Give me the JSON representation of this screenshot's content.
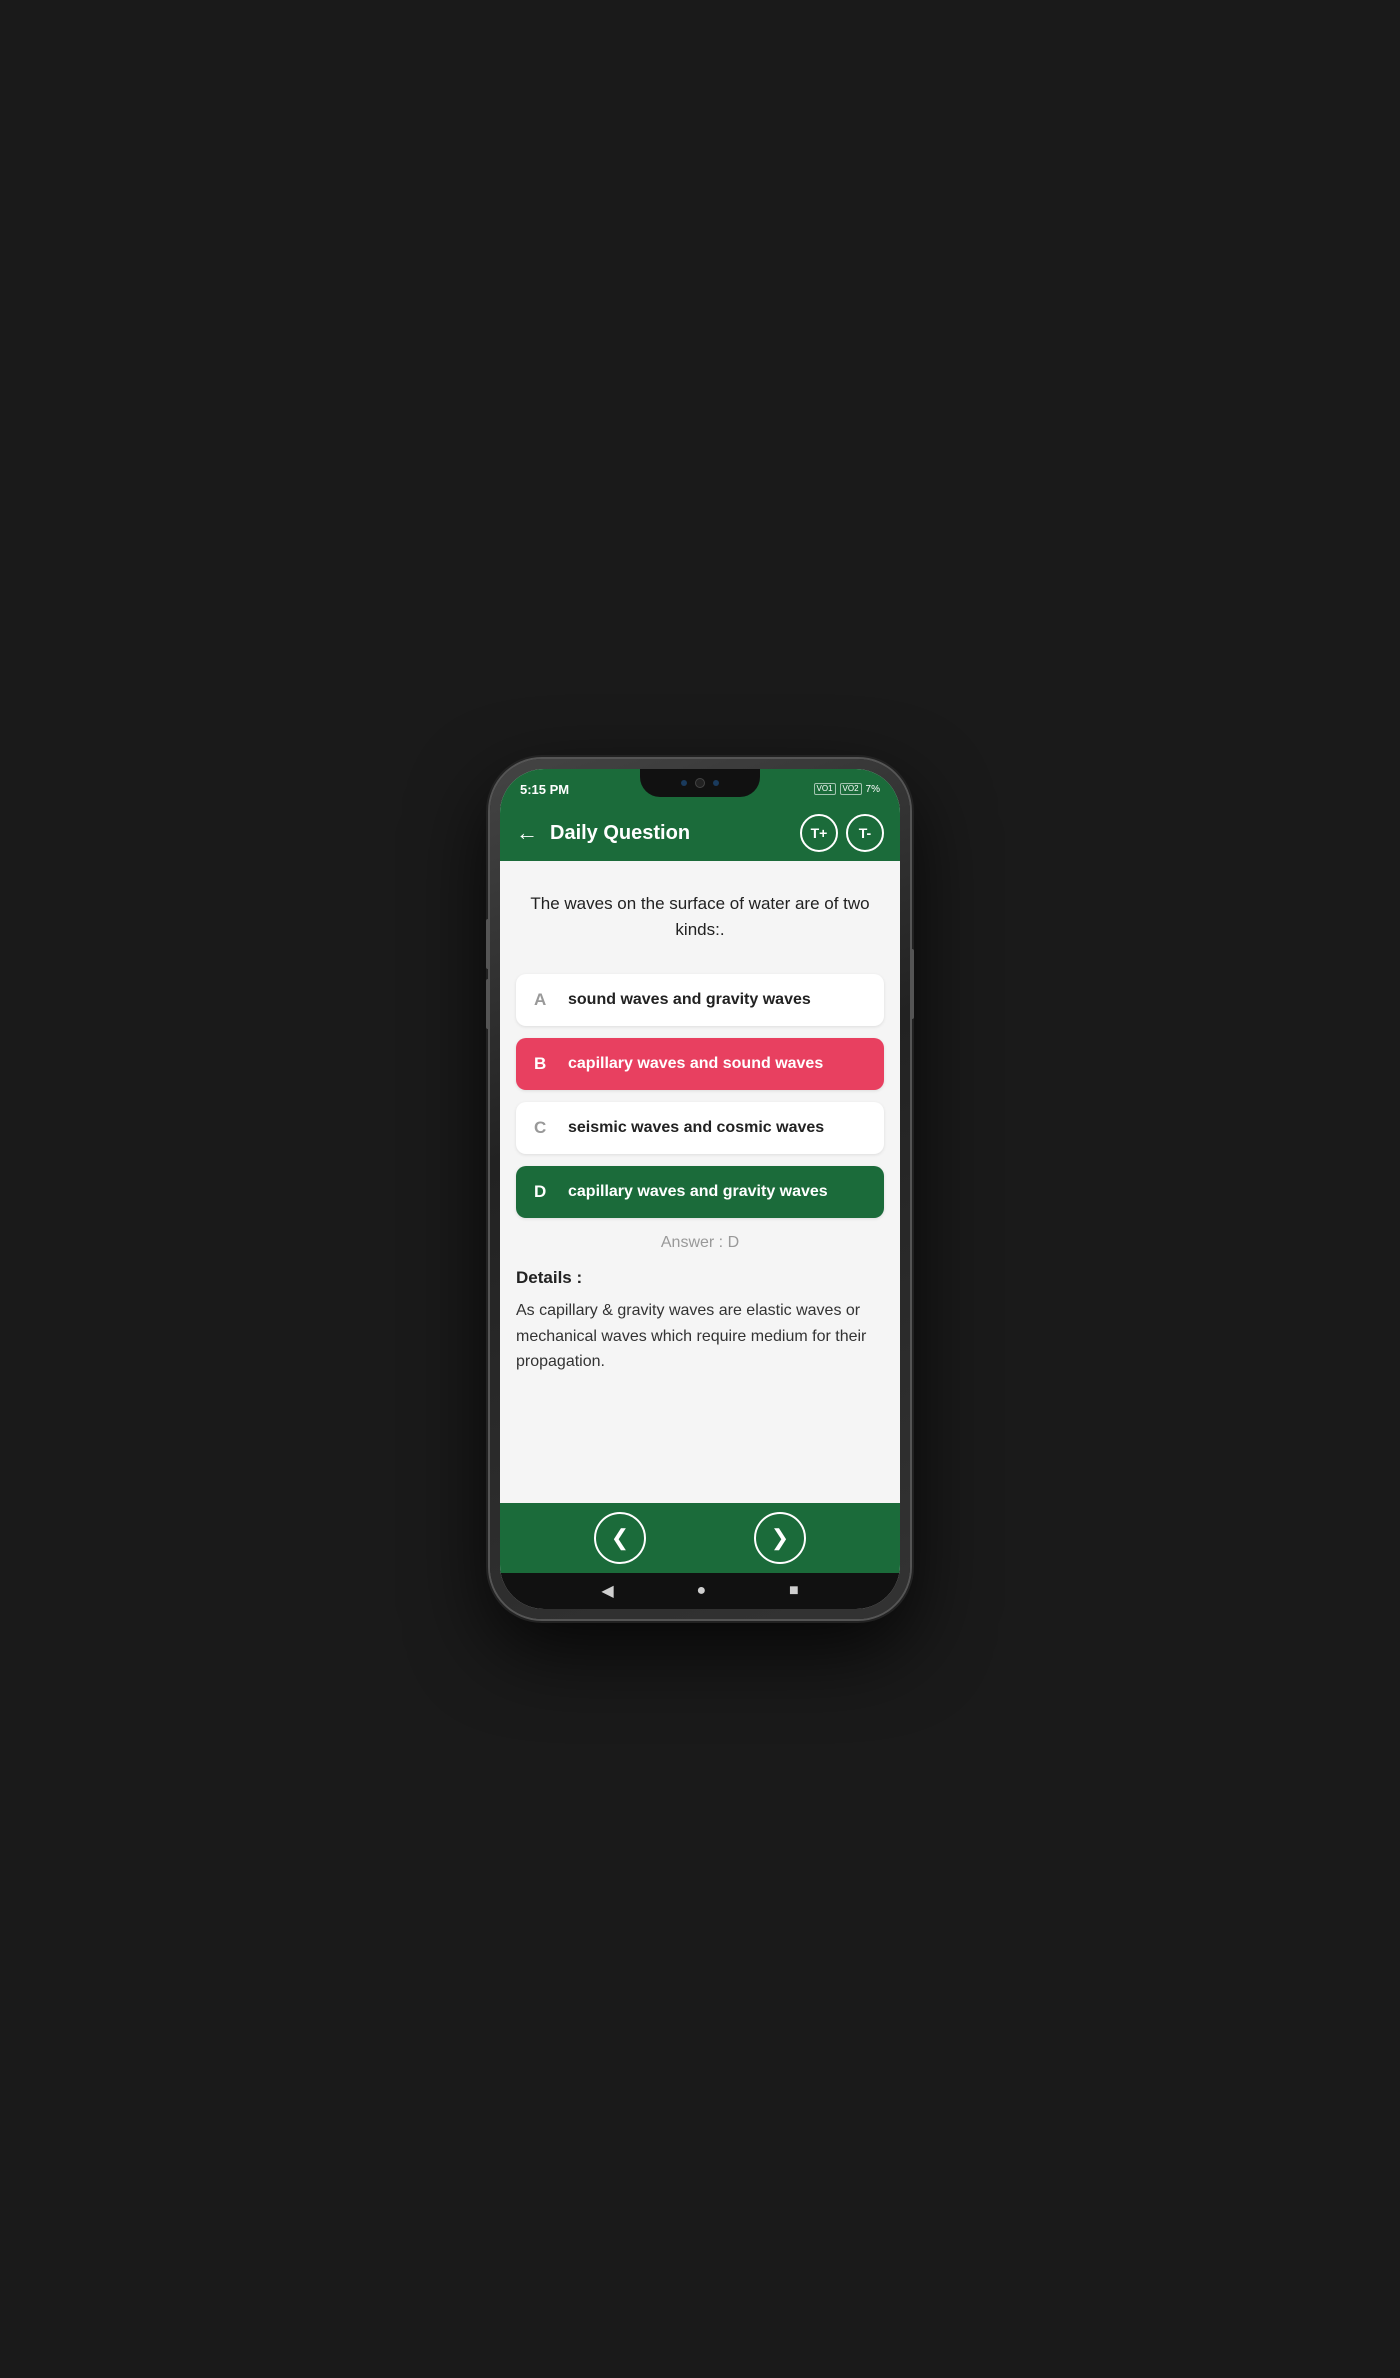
{
  "phone": {
    "status": {
      "time": "5:15 PM",
      "battery": "7%",
      "vol1": "VO1",
      "vol2": "VO2"
    }
  },
  "header": {
    "back_label": "←",
    "title": "Daily Question",
    "text_increase_label": "T+",
    "text_decrease_label": "T-"
  },
  "question": {
    "text": "The waves on the surface of water are of two kinds:."
  },
  "options": [
    {
      "letter": "A",
      "text": "sound waves and gravity waves",
      "state": "normal"
    },
    {
      "letter": "B",
      "text": "capillary waves and sound waves",
      "state": "wrong"
    },
    {
      "letter": "C",
      "text": "seismic waves and cosmic waves",
      "state": "normal"
    },
    {
      "letter": "D",
      "text": "capillary waves and gravity waves",
      "state": "correct"
    }
  ],
  "answer": {
    "label": "Answer : D"
  },
  "details": {
    "heading": "Details :",
    "text": "As capillary & gravity waves are elastic waves or mechanical waves which require medium for their propagation."
  },
  "bottom_nav": {
    "prev_label": "❮",
    "next_label": "❯"
  },
  "android_nav": {
    "back": "◀",
    "home": "●",
    "recent": "■"
  }
}
